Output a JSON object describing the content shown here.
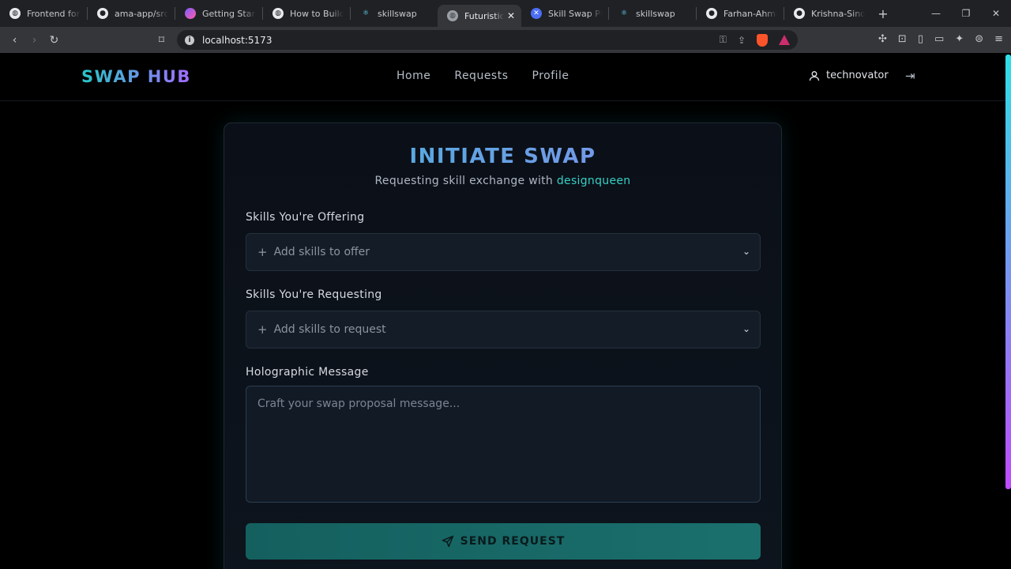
{
  "browser": {
    "tabs": [
      {
        "title": "Frontend for AI",
        "icon": "globe-icon"
      },
      {
        "title": "ama-app/src/ap",
        "icon": "github-icon"
      },
      {
        "title": "Getting Started",
        "icon": "gradient-icon"
      },
      {
        "title": "How to Build a",
        "icon": "globe-icon"
      },
      {
        "title": "skillswap",
        "icon": "react-icon"
      },
      {
        "title": "Futuristic Sk",
        "icon": "globe-icon",
        "active": true
      },
      {
        "title": "Skill Swap Platf",
        "icon": "app-icon"
      },
      {
        "title": "skillswap",
        "icon": "react-icon"
      },
      {
        "title": "Farhan-Ahmad",
        "icon": "github-icon"
      },
      {
        "title": "Krishna-Sinoria",
        "icon": "github-icon"
      }
    ],
    "new_tab": "+",
    "url": "localhost:5173"
  },
  "nav": {
    "logo": "SWAP HUB",
    "links": [
      "Home",
      "Requests",
      "Profile"
    ],
    "username": "technovator"
  },
  "form": {
    "title": "INITIATE SWAP",
    "subtitle_prefix": "Requesting skill exchange with ",
    "subtitle_user": "designqueen",
    "offer_label": "Skills You're Offering",
    "offer_placeholder": "Add skills to offer",
    "request_label": "Skills You're Requesting",
    "request_placeholder": "Add skills to request",
    "message_label": "Holographic Message",
    "message_placeholder": "Craft your swap proposal message...",
    "send_label": "SEND REQUEST"
  },
  "colors": {
    "accent": "#35d0c4",
    "background": "#000000",
    "card": "#0d141d",
    "button": "#1a6f6c"
  }
}
